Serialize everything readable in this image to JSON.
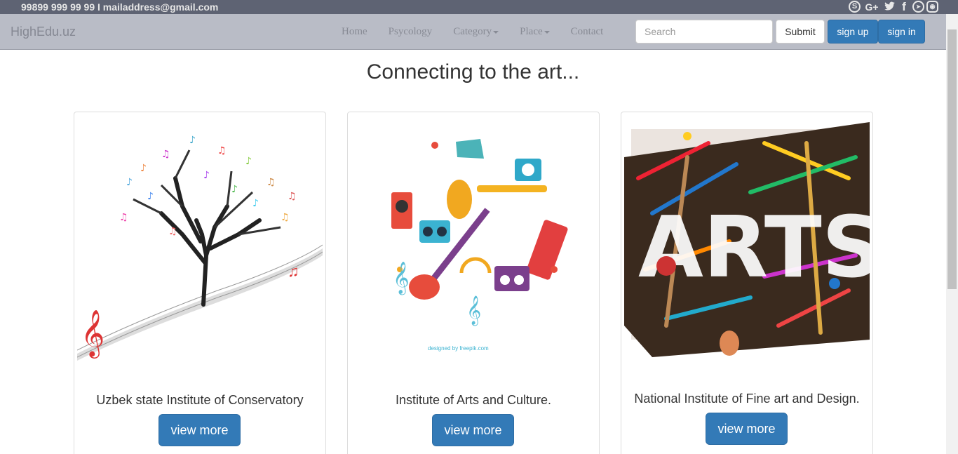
{
  "topbar": {
    "contact": "99899 999 99 99 I mailaddress@gmail.com",
    "social": [
      {
        "icon": "skype-icon",
        "glyph": "S"
      },
      {
        "icon": "google-plus-icon",
        "glyph": "G+"
      },
      {
        "icon": "twitter-icon",
        "glyph": "🐦"
      },
      {
        "icon": "facebook-icon",
        "glyph": "f"
      },
      {
        "icon": "telegram-icon",
        "glyph": "➤"
      },
      {
        "icon": "instagram-icon",
        "glyph": "◉"
      }
    ]
  },
  "navbar": {
    "brand": "HighEdu.uz",
    "items": [
      "Home",
      "Psycology",
      "Category",
      "Place",
      "Contact"
    ],
    "search_placeholder": "Search",
    "submit": "Submit",
    "signup": "sign up",
    "signin": "sign in"
  },
  "main": {
    "headline": "Connecting to the art...",
    "cards": [
      {
        "caption": "Uzbek state Institute of Conservatory",
        "button": "view more",
        "image": "music-tree-illustration"
      },
      {
        "caption": "Institute of Arts and Culture.",
        "button": "view more",
        "image": "musical-instruments-circle-illustration",
        "credit": "designed by freepik.com"
      },
      {
        "caption": "National Institute of Fine art and Design.",
        "button": "view more",
        "image": "arts-supplies-lettering-photo"
      }
    ]
  },
  "colors": {
    "topbar": "#5e6373",
    "navbar": "#b9bcc6",
    "primary": "#337ab7"
  }
}
